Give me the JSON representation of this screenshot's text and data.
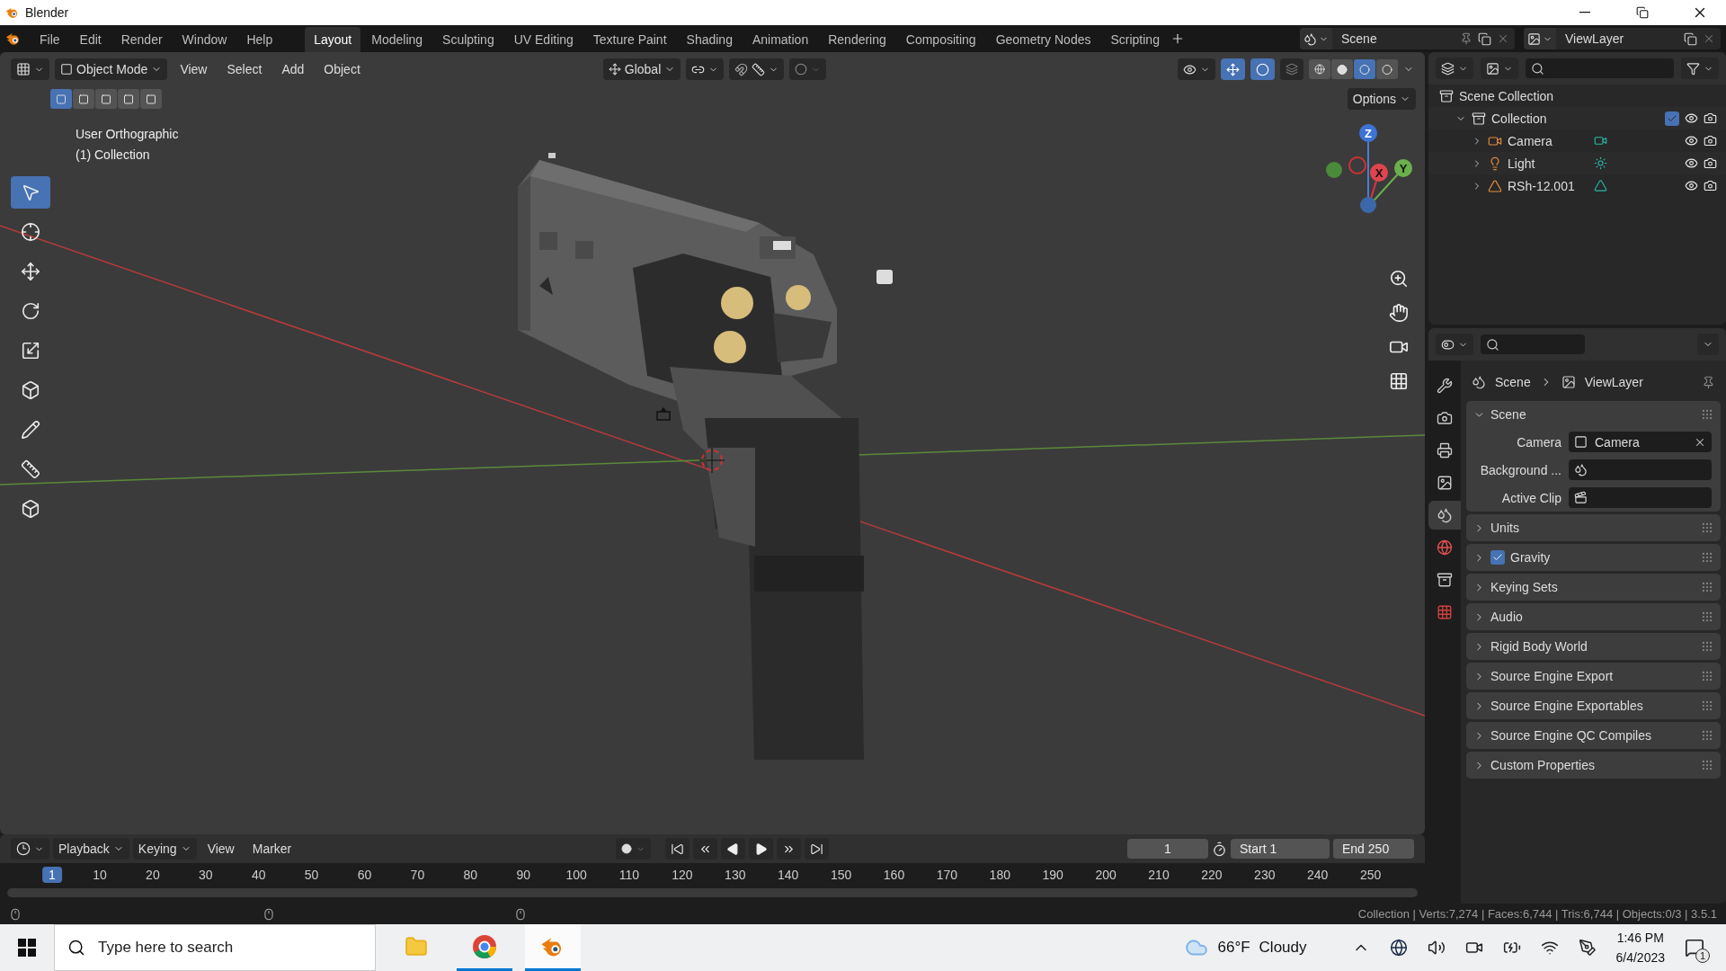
{
  "window": {
    "title": "Blender"
  },
  "menu": [
    "File",
    "Edit",
    "Render",
    "Window",
    "Help"
  ],
  "workspaces": [
    {
      "label": "Layout",
      "selected": true
    },
    {
      "label": "Modeling",
      "selected": false
    },
    {
      "label": "Sculpting",
      "selected": false
    },
    {
      "label": "UV Editing",
      "selected": false
    },
    {
      "label": "Texture Paint",
      "selected": false
    },
    {
      "label": "Shading",
      "selected": false
    },
    {
      "label": "Animation",
      "selected": false
    },
    {
      "label": "Rendering",
      "selected": false
    },
    {
      "label": "Compositing",
      "selected": false
    },
    {
      "label": "Geometry Nodes",
      "selected": false
    },
    {
      "label": "Scripting",
      "selected": false
    }
  ],
  "scene_selector": {
    "value": "Scene"
  },
  "view_layer_selector": {
    "value": "ViewLayer"
  },
  "viewport_header": {
    "mode": "Object Mode",
    "menus": [
      "View",
      "Select",
      "Add",
      "Object"
    ],
    "orientation": "Global",
    "options": "Options",
    "gizmos_on": true,
    "overlays_on": true
  },
  "select_modes": [
    {
      "selected": true
    },
    {
      "selected": false
    },
    {
      "selected": false
    },
    {
      "selected": false
    },
    {
      "selected": false
    }
  ],
  "shading_modes": [
    {
      "selected": false
    },
    {
      "selected": false
    },
    {
      "selected": true
    },
    {
      "selected": false
    }
  ],
  "viewport_info": [
    "User Orthographic",
    "(1) Collection"
  ],
  "tools": [
    {
      "selected": true
    },
    {
      "selected": false
    },
    {
      "selected": false
    },
    {
      "selected": false
    },
    {
      "selected": false
    },
    {
      "selected": false
    },
    {
      "selected": false
    },
    {
      "selected": false
    },
    {
      "selected": false
    }
  ],
  "gizmo_axes": [
    "Z",
    "X",
    "Y"
  ],
  "outliner": {
    "items": [
      {
        "label": "Scene Collection",
        "kind": "scene",
        "children": [
          {
            "label": "Collection",
            "kind": "collection",
            "expanded": true,
            "checked": true,
            "children": [
              {
                "label": "Camera",
                "kind": "camera",
                "expanded": false
              },
              {
                "label": "Light",
                "kind": "light",
                "expanded": false
              },
              {
                "label": "RSh-12.001",
                "kind": "mesh",
                "expanded": false
              }
            ]
          }
        ]
      }
    ]
  },
  "properties": {
    "breadcrumb": [
      "Scene",
      "ViewLayer"
    ],
    "tabs": [
      {
        "selected": false
      },
      {
        "selected": false
      },
      {
        "selected": false
      },
      {
        "selected": false
      },
      {
        "selected": true
      },
      {
        "selected": false
      },
      {
        "selected": false
      },
      {
        "selected": false
      }
    ],
    "panels": [
      {
        "label": "Scene",
        "kind": "plain",
        "expanded": true,
        "fields": [
          {
            "label": "Camera",
            "value": "Camera",
            "kind": "camera"
          },
          {
            "label": "Background ...",
            "kind": "scene"
          },
          {
            "label": "Active Clip",
            "kind": "clip"
          }
        ]
      },
      {
        "label": "Units",
        "kind": "plain",
        "expanded": false
      },
      {
        "label": "Gravity",
        "kind": "toggle",
        "checked": true,
        "expanded": false
      },
      {
        "label": "Keying Sets",
        "kind": "plain",
        "expanded": false
      },
      {
        "label": "Audio",
        "kind": "plain",
        "expanded": false
      },
      {
        "label": "Rigid Body World",
        "kind": "plain",
        "expanded": false
      },
      {
        "label": "Source Engine Export",
        "kind": "plain",
        "expanded": false
      },
      {
        "label": "Source Engine Exportables",
        "kind": "plain",
        "expanded": false
      },
      {
        "label": "Source Engine QC Compiles",
        "kind": "plain",
        "expanded": false
      },
      {
        "label": "Custom Properties",
        "kind": "plain",
        "expanded": false
      }
    ]
  },
  "timeline": {
    "menus": [
      "Playback",
      "Keying",
      "View",
      "Marker"
    ],
    "current_frame": "1",
    "start_label": "Start",
    "start": "1",
    "end_label": "End",
    "end": "250",
    "ruler": [
      {
        "label": "1",
        "selected": true
      },
      {
        "label": "10",
        "selected": false
      },
      {
        "label": "20",
        "selected": false
      },
      {
        "label": "30",
        "selected": false
      },
      {
        "label": "40",
        "selected": false
      },
      {
        "label": "50",
        "selected": false
      },
      {
        "label": "60",
        "selected": false
      },
      {
        "label": "70",
        "selected": false
      },
      {
        "label": "80",
        "selected": false
      },
      {
        "label": "90",
        "selected": false
      },
      {
        "label": "100",
        "selected": false
      },
      {
        "label": "110",
        "selected": false
      },
      {
        "label": "120",
        "selected": false
      },
      {
        "label": "130",
        "selected": false
      },
      {
        "label": "140",
        "selected": false
      },
      {
        "label": "150",
        "selected": false
      },
      {
        "label": "160",
        "selected": false
      },
      {
        "label": "170",
        "selected": false
      },
      {
        "label": "180",
        "selected": false
      },
      {
        "label": "190",
        "selected": false
      },
      {
        "label": "200",
        "selected": false
      },
      {
        "label": "210",
        "selected": false
      },
      {
        "label": "220",
        "selected": false
      },
      {
        "label": "230",
        "selected": false
      },
      {
        "label": "240",
        "selected": false
      },
      {
        "label": "250",
        "selected": false
      }
    ]
  },
  "status_bar": "Collection | Verts:7,274 | Faces:6,744 | Tris:6,744 | Objects:0/3 | 3.5.1",
  "taskbar": {
    "search_placeholder": "Type here to search",
    "apps": [
      {
        "kind": "folder",
        "running": false,
        "selected": false
      },
      {
        "kind": "chrome",
        "running": true,
        "selected": false
      },
      {
        "kind": "blender",
        "running": true,
        "selected": true
      }
    ],
    "temperature": "66°F",
    "weather": "Cloudy",
    "time": "1:46 PM",
    "date": "6/4/2023",
    "notifications": "1"
  }
}
